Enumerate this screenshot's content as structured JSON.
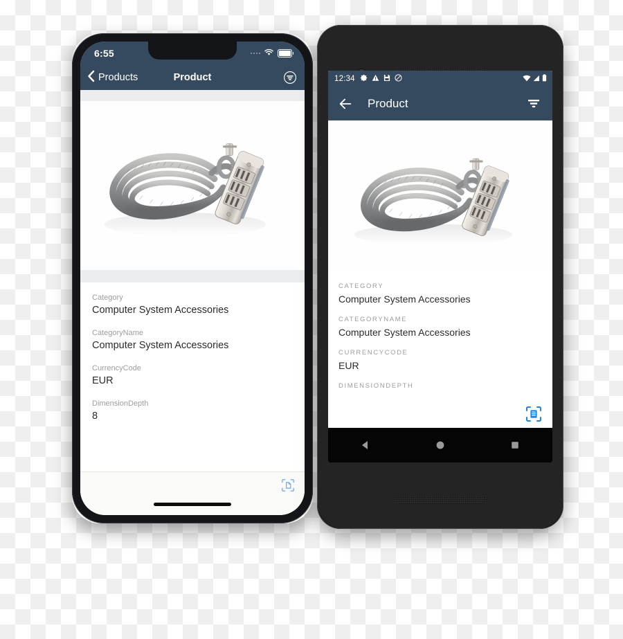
{
  "colors": {
    "header": "#354a5f",
    "ios_accent": "#7aafe8",
    "android_accent": "#1f82e0",
    "label_gray": "#9a9da1",
    "value_dark": "#2b2b2e",
    "ios_band": "#ebedef"
  },
  "ios": {
    "status": {
      "time": "6:55",
      "signal_icon": "signal-dots-icon",
      "wifi_icon": "wifi-icon",
      "battery_icon": "battery-icon"
    },
    "navbar": {
      "back_label": "Products",
      "back_icon": "chevron-left-icon",
      "title": "Product",
      "filter_icon": "filter-circle-icon"
    },
    "product_image_alt": "Coiled steel cable combination lock",
    "fields": [
      {
        "label": "Category",
        "value": "Computer System Accessories"
      },
      {
        "label": "CategoryName",
        "value": "Computer System Accessories"
      },
      {
        "label": "CurrencyCode",
        "value": "EUR"
      },
      {
        "label": "DimensionDepth",
        "value": "8"
      }
    ],
    "toolbar": {
      "scan_icon": "scan-document-icon"
    },
    "home_indicator": "home-indicator"
  },
  "android": {
    "status": {
      "time": "12:34",
      "sys_icons": [
        "gear-icon",
        "warning-icon",
        "save-icon",
        "do-not-disturb-icon"
      ],
      "wifi_icon": "wifi-icon",
      "signal_icon": "signal-triangle-icon",
      "battery_icon": "battery-icon"
    },
    "appbar": {
      "back_icon": "arrow-left-icon",
      "title": "Product",
      "filter_icon": "filter-icon"
    },
    "product_image_alt": "Coiled steel cable combination lock",
    "fields": [
      {
        "label": "CATEGORY",
        "value": "Computer System Accessories"
      },
      {
        "label": "CATEGORYNAME",
        "value": "Computer System Accessories"
      },
      {
        "label": "CURRENCYCODE",
        "value": "EUR"
      },
      {
        "label": "DIMENSIONDEPTH",
        "value": ""
      }
    ],
    "fab": {
      "scan_icon": "scan-document-icon"
    },
    "navbar": {
      "back_icon": "nav-back-triangle-icon",
      "home_icon": "nav-home-circle-icon",
      "recents_icon": "nav-recents-square-icon"
    }
  }
}
